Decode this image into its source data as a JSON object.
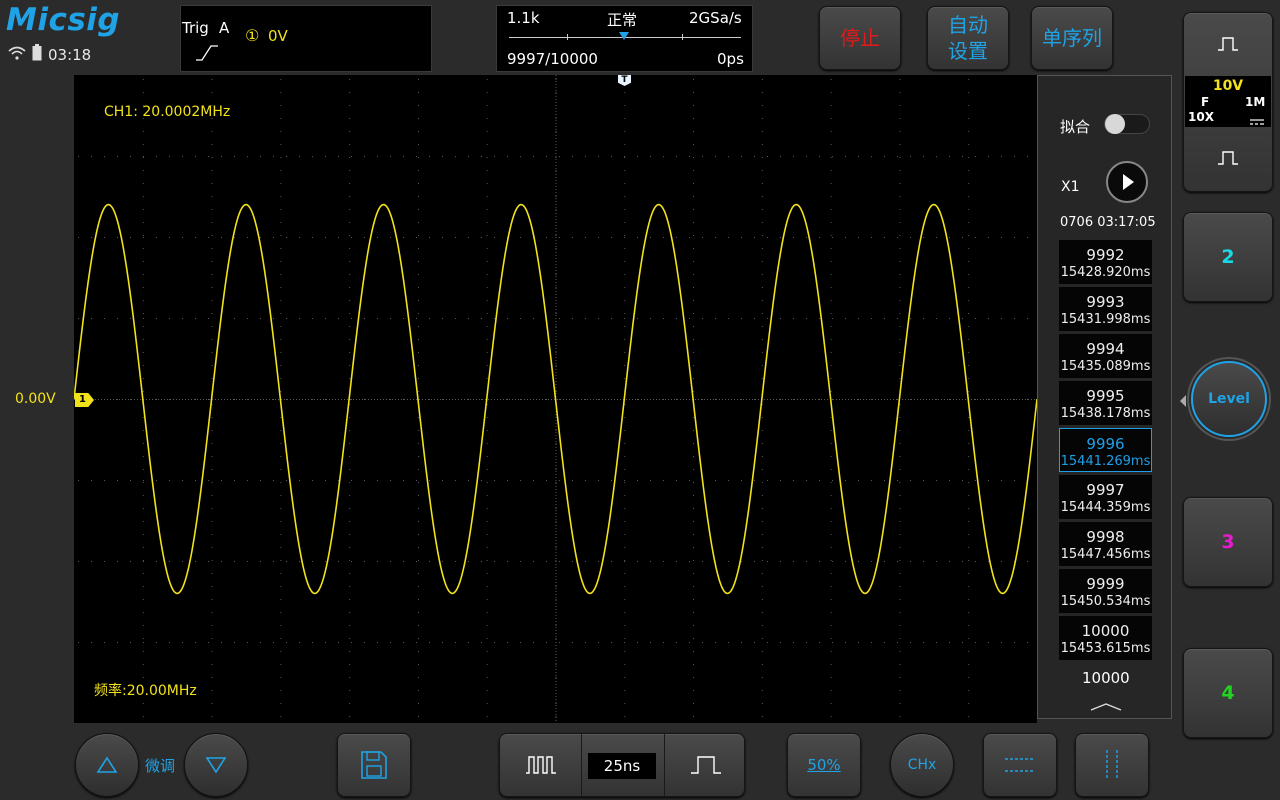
{
  "brand": {
    "logo": "Micsig",
    "time": "03:18"
  },
  "trigger": {
    "label": "Trig",
    "source": "A",
    "channel_mark": "①",
    "level": "0V"
  },
  "acquisition": {
    "memory": "1.1k",
    "mode": "正常",
    "sample_rate": "2GSa/s",
    "frame": "9997/10000",
    "offset": "0ps"
  },
  "top_buttons": {
    "stop": "停止",
    "auto_line1": "自动",
    "auto_line2": "设置",
    "single": "单序列"
  },
  "screen": {
    "ch1_freq": "CH1: 20.0002MHz",
    "freq_readout": "频率:20.00MHz",
    "ground_level": "0.00V",
    "ch1_marker": "1",
    "trigger_marker": "T"
  },
  "history": {
    "fit_label": "拟合",
    "speed": "X1",
    "timestamp": "0706 03:17:05",
    "frames": [
      {
        "n": "9992",
        "t": "15428.920ms"
      },
      {
        "n": "9993",
        "t": "15431.998ms"
      },
      {
        "n": "9994",
        "t": "15435.089ms"
      },
      {
        "n": "9995",
        "t": "15438.178ms"
      },
      {
        "n": "9996",
        "t": "15441.269ms"
      },
      {
        "n": "9997",
        "t": "15444.359ms"
      },
      {
        "n": "9998",
        "t": "15447.456ms"
      },
      {
        "n": "9999",
        "t": "15450.534ms"
      },
      {
        "n": "10000",
        "t": "15453.615ms"
      }
    ],
    "selected_index": 4,
    "total": "10000"
  },
  "channels": {
    "ch1_volts": "10V",
    "ch1_coupling": "F",
    "ch1_impedance": "1M",
    "ch1_probe": "10X",
    "ch2": "2",
    "ch3": "3",
    "ch4": "4",
    "level": "Level"
  },
  "bottom": {
    "fine_adjust": "微调",
    "timebase": "25ns",
    "half": "50%",
    "chx": "CHx"
  },
  "colors": {
    "ch1": "#f2e21a",
    "ch2": "#18d8e8",
    "ch3": "#e81ad0",
    "ch4": "#22d322",
    "accent": "#1fa3e6"
  },
  "signal": {
    "frequency_mhz": 20.0002,
    "timebase_ns_per_div": 25,
    "amplitude_div": 2.4
  }
}
